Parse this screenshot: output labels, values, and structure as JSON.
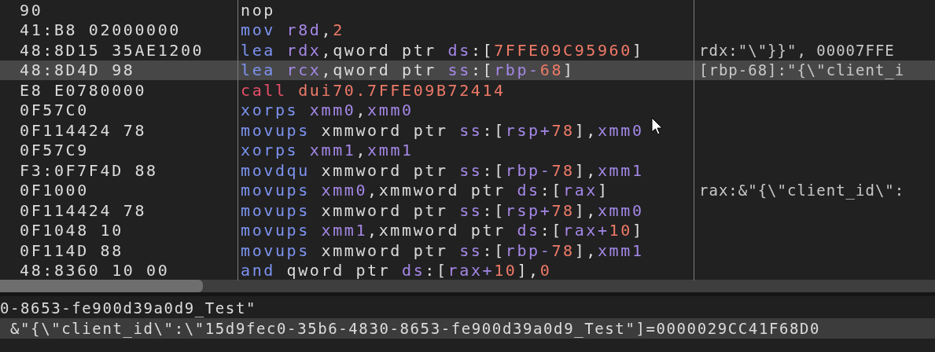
{
  "disassembly": {
    "rows": [
      {
        "bytes": "90",
        "selected": false,
        "tokens": [
          {
            "kind": "text",
            "text": "nop"
          }
        ]
      },
      {
        "bytes": "41:B8 02000000",
        "selected": false,
        "tokens": [
          {
            "kind": "mnemonic",
            "text": "mov "
          },
          {
            "kind": "register",
            "text": "r8d"
          },
          {
            "kind": "text",
            "text": ","
          },
          {
            "kind": "number",
            "text": "2"
          }
        ]
      },
      {
        "bytes": "48:8D15 35AE1200",
        "selected": false,
        "comment": "rdx:\"\\\"}}\", 00007FFE",
        "tokens": [
          {
            "kind": "mnemonic",
            "text": "lea "
          },
          {
            "kind": "register",
            "text": "rdx"
          },
          {
            "kind": "text",
            "text": ",qword ptr "
          },
          {
            "kind": "register",
            "text": "ds"
          },
          {
            "kind": "text",
            "text": ":["
          },
          {
            "kind": "number",
            "text": "7FFE09C95960"
          },
          {
            "kind": "text",
            "text": "]"
          }
        ]
      },
      {
        "bytes": "48:8D4D 98",
        "selected": true,
        "comment": "[rbp-68]:\"{\\\"client_i",
        "tokens": [
          {
            "kind": "mnemonic",
            "text": "lea "
          },
          {
            "kind": "register",
            "text": "rcx"
          },
          {
            "kind": "text",
            "text": ",qword ptr "
          },
          {
            "kind": "register",
            "text": "ss"
          },
          {
            "kind": "text",
            "text": ":["
          },
          {
            "kind": "register",
            "text": "rbp-"
          },
          {
            "kind": "number",
            "text": "68"
          },
          {
            "kind": "text",
            "text": "]"
          }
        ]
      },
      {
        "bytes": "E8 E0780000",
        "selected": false,
        "tokens": [
          {
            "kind": "call",
            "text": "call "
          },
          {
            "kind": "number",
            "text": "dui70.7FFE09B72414"
          }
        ]
      },
      {
        "bytes": "0F57C0",
        "selected": false,
        "tokens": [
          {
            "kind": "mnemonic",
            "text": "xorps "
          },
          {
            "kind": "register",
            "text": "xmm0"
          },
          {
            "kind": "text",
            "text": ","
          },
          {
            "kind": "register",
            "text": "xmm0"
          }
        ]
      },
      {
        "bytes": "0F114424 78",
        "selected": false,
        "tokens": [
          {
            "kind": "mnemonic",
            "text": "movups "
          },
          {
            "kind": "text",
            "text": "xmmword ptr "
          },
          {
            "kind": "register",
            "text": "ss"
          },
          {
            "kind": "text",
            "text": ":["
          },
          {
            "kind": "register",
            "text": "rsp+"
          },
          {
            "kind": "number",
            "text": "78"
          },
          {
            "kind": "text",
            "text": "],"
          },
          {
            "kind": "register",
            "text": "xmm0"
          }
        ]
      },
      {
        "bytes": "0F57C9",
        "selected": false,
        "tokens": [
          {
            "kind": "mnemonic",
            "text": "xorps "
          },
          {
            "kind": "register",
            "text": "xmm1"
          },
          {
            "kind": "text",
            "text": ","
          },
          {
            "kind": "register",
            "text": "xmm1"
          }
        ]
      },
      {
        "bytes": "F3:0F7F4D 88",
        "selected": false,
        "tokens": [
          {
            "kind": "mnemonic",
            "text": "movdqu "
          },
          {
            "kind": "text",
            "text": "xmmword ptr "
          },
          {
            "kind": "register",
            "text": "ss"
          },
          {
            "kind": "text",
            "text": ":["
          },
          {
            "kind": "register",
            "text": "rbp-"
          },
          {
            "kind": "number",
            "text": "78"
          },
          {
            "kind": "text",
            "text": "],"
          },
          {
            "kind": "register",
            "text": "xmm1"
          }
        ]
      },
      {
        "bytes": "0F1000",
        "selected": false,
        "comment": "rax:&\"{\\\"client_id\\\":",
        "tokens": [
          {
            "kind": "mnemonic",
            "text": "movups "
          },
          {
            "kind": "register",
            "text": "xmm0"
          },
          {
            "kind": "text",
            "text": ",xmmword ptr "
          },
          {
            "kind": "register",
            "text": "ds"
          },
          {
            "kind": "text",
            "text": ":["
          },
          {
            "kind": "register",
            "text": "rax"
          },
          {
            "kind": "text",
            "text": "]"
          }
        ]
      },
      {
        "bytes": "0F114424 78",
        "selected": false,
        "tokens": [
          {
            "kind": "mnemonic",
            "text": "movups "
          },
          {
            "kind": "text",
            "text": "xmmword ptr "
          },
          {
            "kind": "register",
            "text": "ss"
          },
          {
            "kind": "text",
            "text": ":["
          },
          {
            "kind": "register",
            "text": "rsp+"
          },
          {
            "kind": "number",
            "text": "78"
          },
          {
            "kind": "text",
            "text": "],"
          },
          {
            "kind": "register",
            "text": "xmm0"
          }
        ]
      },
      {
        "bytes": "0F1048 10",
        "selected": false,
        "tokens": [
          {
            "kind": "mnemonic",
            "text": "movups "
          },
          {
            "kind": "register",
            "text": "xmm1"
          },
          {
            "kind": "text",
            "text": ",xmmword ptr "
          },
          {
            "kind": "register",
            "text": "ds"
          },
          {
            "kind": "text",
            "text": ":["
          },
          {
            "kind": "register",
            "text": "rax+"
          },
          {
            "kind": "number",
            "text": "10"
          },
          {
            "kind": "text",
            "text": "]"
          }
        ]
      },
      {
        "bytes": "0F114D 88",
        "selected": false,
        "tokens": [
          {
            "kind": "mnemonic",
            "text": "movups "
          },
          {
            "kind": "text",
            "text": "xmmword ptr "
          },
          {
            "kind": "register",
            "text": "ss"
          },
          {
            "kind": "text",
            "text": ":["
          },
          {
            "kind": "register",
            "text": "rbp-"
          },
          {
            "kind": "number",
            "text": "78"
          },
          {
            "kind": "text",
            "text": "],"
          },
          {
            "kind": "register",
            "text": "xmm1"
          }
        ]
      },
      {
        "bytes": "48:8360 10 00",
        "selected": false,
        "tokens": [
          {
            "kind": "mnemonic",
            "text": "and "
          },
          {
            "kind": "text",
            "text": "qword ptr "
          },
          {
            "kind": "register",
            "text": "ds"
          },
          {
            "kind": "text",
            "text": ":["
          },
          {
            "kind": "register",
            "text": "rax+"
          },
          {
            "kind": "number",
            "text": "10"
          },
          {
            "kind": "text",
            "text": "],"
          },
          {
            "kind": "number",
            "text": "0"
          }
        ]
      }
    ]
  },
  "info_pane": {
    "lines": [
      {
        "text": "0-8653-fe900d39a0d9_Test\"",
        "selected": false
      },
      {
        "text": " &\"{\\\"client_id\\\":\\\"15d9fec0-35b6-4830-8653-fe900d39a0d9_Test\"]=0000029CC41F68D0",
        "selected": true
      }
    ]
  }
}
